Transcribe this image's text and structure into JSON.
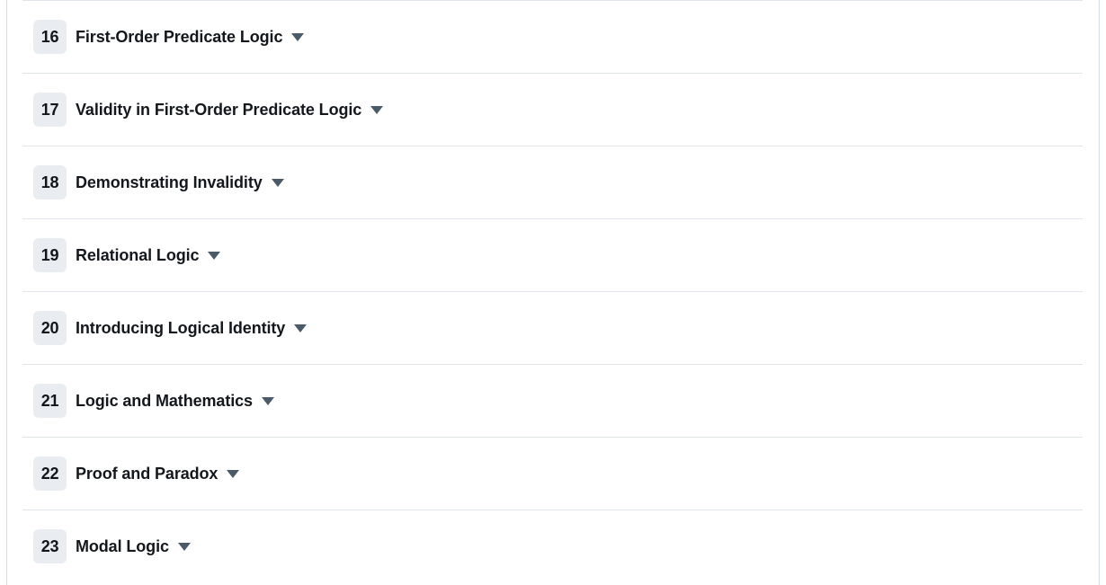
{
  "theme": {
    "background": "#ffffff",
    "row_divider": "#dfe5ea",
    "frame_rule": "#d6dde2",
    "badge_background": "#e9edf1",
    "badge_text": "#12161a",
    "title_text": "#14181c",
    "caret_color": "#4a5a68"
  },
  "chapter_list": {
    "caret_icon": "chevron-down-icon",
    "rows": [
      {
        "number": "16",
        "title": "First-Order Predicate Logic"
      },
      {
        "number": "17",
        "title": "Validity in First-Order Predicate Logic"
      },
      {
        "number": "18",
        "title": "Demonstrating Invalidity"
      },
      {
        "number": "19",
        "title": "Relational Logic"
      },
      {
        "number": "20",
        "title": "Introducing Logical Identity"
      },
      {
        "number": "21",
        "title": "Logic and Mathematics"
      },
      {
        "number": "22",
        "title": "Proof and Paradox"
      },
      {
        "number": "23",
        "title": "Modal Logic"
      }
    ]
  }
}
